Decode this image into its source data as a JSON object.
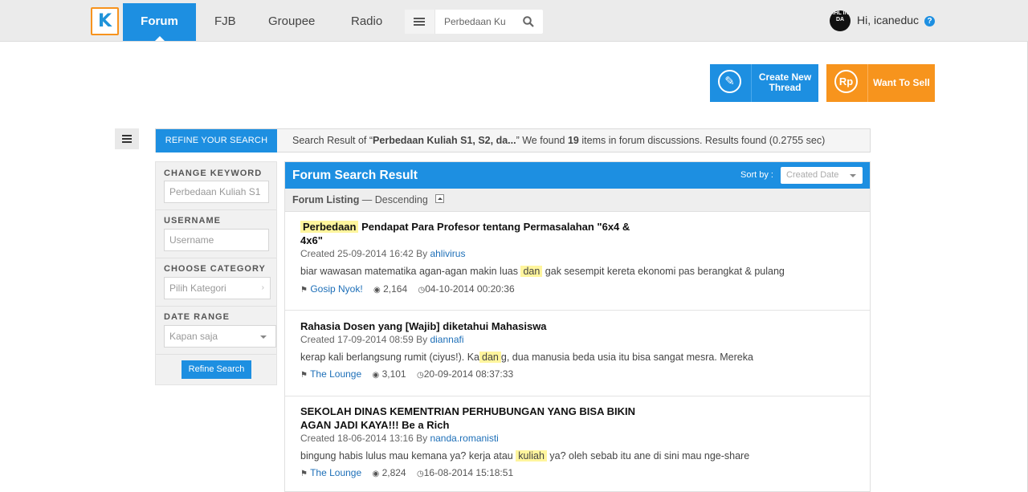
{
  "nav": {
    "logo_text": "K",
    "items": [
      "Forum",
      "FJB",
      "Groupee",
      "Radio"
    ],
    "search_value": "Perbedaan Ku",
    "user_initials": "AHL INI DA",
    "greeting": "Hi, icaneduc",
    "help": "?"
  },
  "actions": {
    "create_icon": "✎",
    "create_line1": "Create New",
    "create_line2": "Thread",
    "sell_icon": "Rp",
    "sell_label": "Want To Sell"
  },
  "refine": {
    "tab_label": "REFINE YOUR SEARCH",
    "result_prefix": "Search Result of “",
    "result_query": "Perbedaan Kuliah S1, S2, da...",
    "result_mid": "” We found ",
    "result_count": "19",
    "result_suffix": " items in forum discussions. Results found (0.2755 sec)",
    "keyword_label": "CHANGE KEYWORD",
    "keyword_value": "Perbedaan Kuliah S1",
    "username_label": "USERNAME",
    "username_placeholder": "Username",
    "category_label": "CHOOSE CATEGORY",
    "category_placeholder": "Pilih Kategori",
    "date_label": "DATE RANGE",
    "date_value": "Kapan saja",
    "button": "Refine Search"
  },
  "results": {
    "title": "Forum Search Result",
    "sort_label": "Sort by :",
    "sort_value": "Created Date",
    "listing_label": "Forum Listing",
    "listing_order": " — Descending",
    "items": [
      {
        "title_hl": "Perbedaan",
        "title": " Pendapat Para Profesor tentang Permasalahan \"6x4 & 4x6\"",
        "created": "Created 25-09-2014 16:42 By ",
        "author": "ahlivirus",
        "ex_pre": "biar wawasan matematika agan-agan makin luas ",
        "ex_hl": "dan",
        "ex_post": " gak sesempit kereta ekonomi pas berangkat & pulang",
        "tag": "Gosip Nyok!",
        "views": "2,164",
        "last": "04-10-2014 00:20:36"
      },
      {
        "title_hl": "",
        "title": "Rahasia Dosen yang [Wajib] diketahui Mahasiswa",
        "created": "Created 17-09-2014 08:59 By ",
        "author": "diannafi",
        "ex_pre": "kerap kali berlangsung rumit (ciyus!). Ka",
        "ex_hl": "dan",
        "ex_post": "g, dua manusia beda usia itu bisa sangat mesra. Mereka",
        "tag": "The Lounge",
        "views": "3,101",
        "last": "20-09-2014 08:37:33"
      },
      {
        "title_hl": "",
        "title": "SEKOLAH DINAS KEMENTRIAN PERHUBUNGAN YANG BISA BIKIN AGAN JADI KAYA!!! Be a Rich",
        "created": "Created 18-06-2014 13:16 By ",
        "author": "nanda.romanisti",
        "ex_pre": "bingung habis lulus mau kemana ya? kerja atau ",
        "ex_hl": "kuliah",
        "ex_post": " ya? oleh sebab itu ane di sini mau nge-share",
        "tag": "The Lounge",
        "views": "2,824",
        "last": "16-08-2014 15:18:51"
      }
    ]
  },
  "icons": {
    "tag": "tag-icon",
    "eye": "eye-icon",
    "clock": "clock-icon",
    "search": "search-icon",
    "menu": "menu-icon"
  },
  "colors": {
    "primary": "#1d8fe1",
    "accent": "#f7941d",
    "highlight": "#fff59d"
  }
}
